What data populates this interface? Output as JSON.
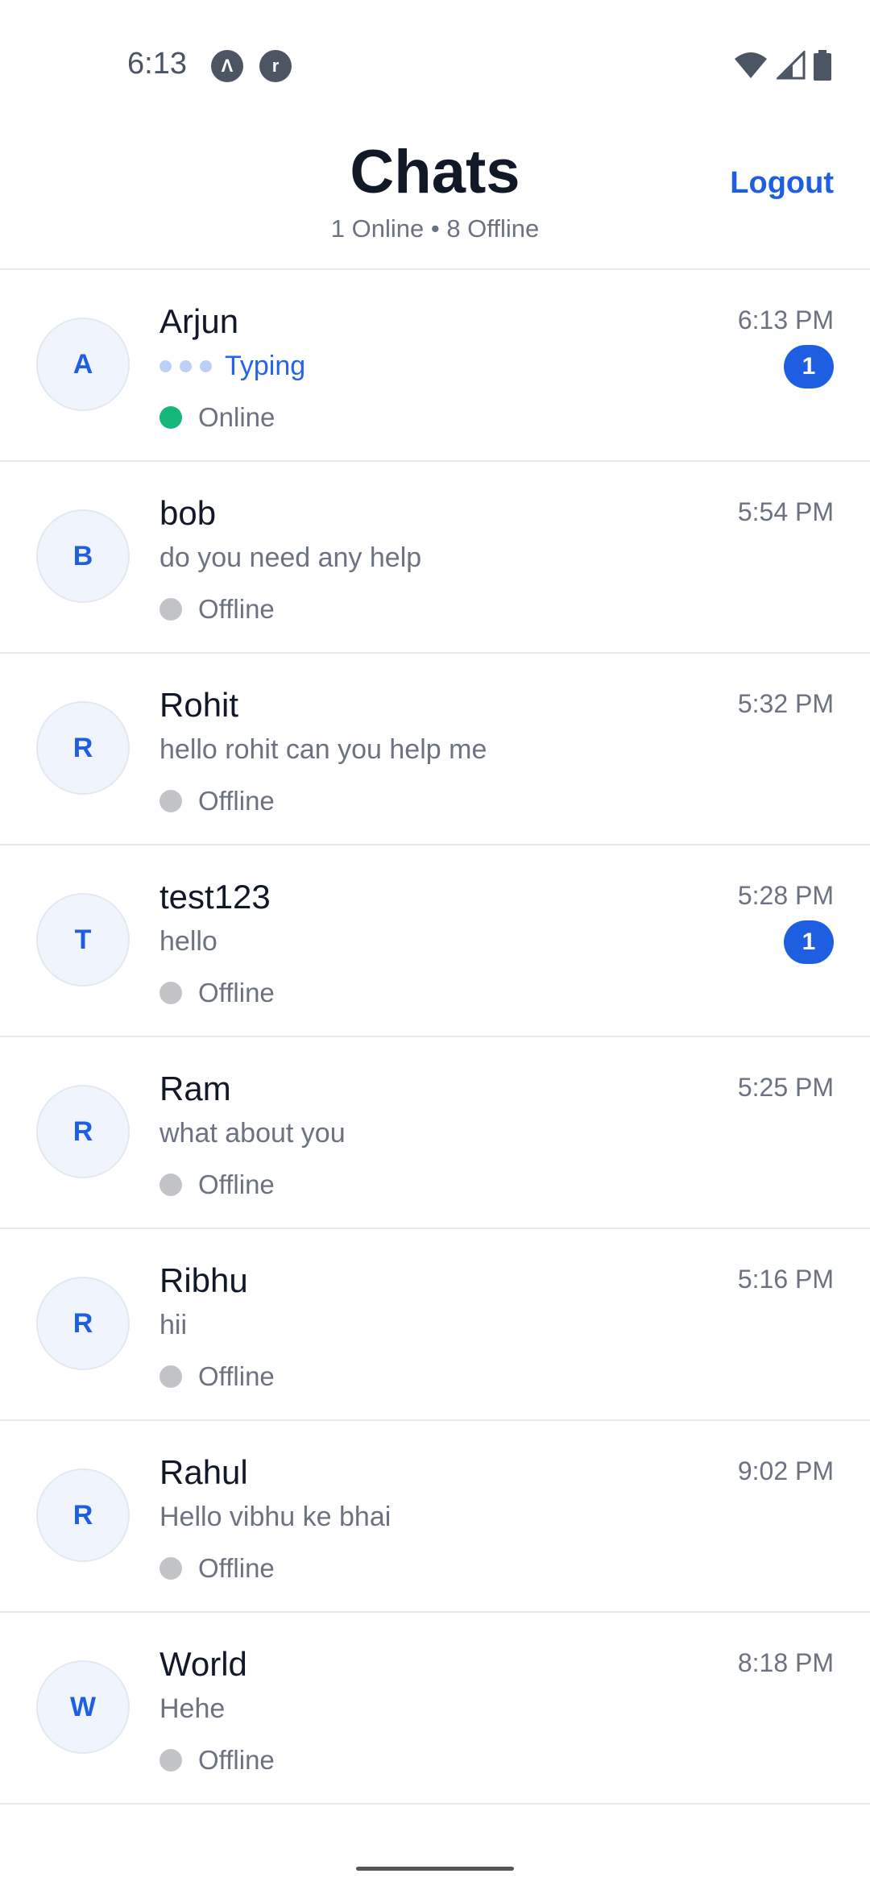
{
  "status_bar": {
    "time": "6:13",
    "icons": [
      "app-icon-a",
      "app-icon-r",
      "wifi-icon",
      "signal-icon",
      "battery-icon"
    ]
  },
  "header": {
    "title": "Chats",
    "subtitle": "1 Online • 8 Offline",
    "logout_label": "Logout"
  },
  "colors": {
    "accent": "#1d5fe0",
    "online": "#16b87a",
    "offline": "#c3c4c8"
  },
  "chats": [
    {
      "initial": "A",
      "name": "Arjun",
      "preview": "Typing",
      "typing": true,
      "status": "Online",
      "time": "6:13 PM",
      "unread": "1"
    },
    {
      "initial": "B",
      "name": "bob",
      "preview": "do you need any help",
      "status": "Offline",
      "time": "5:54 PM"
    },
    {
      "initial": "R",
      "name": "Rohit",
      "preview": "hello rohit can you help me",
      "status": "Offline",
      "time": "5:32 PM"
    },
    {
      "initial": "T",
      "name": "test123",
      "preview": "hello",
      "status": "Offline",
      "time": "5:28 PM",
      "unread": "1"
    },
    {
      "initial": "R",
      "name": "Ram",
      "preview": "what about you",
      "status": "Offline",
      "time": "5:25 PM"
    },
    {
      "initial": "R",
      "name": "Ribhu",
      "preview": "hii",
      "status": "Offline",
      "time": "5:16 PM"
    },
    {
      "initial": "R",
      "name": "Rahul",
      "preview": "Hello vibhu ke bhai",
      "status": "Offline",
      "time": "9:02 PM"
    },
    {
      "initial": "W",
      "name": "World",
      "preview": "Hehe",
      "status": "Offline",
      "time": "8:18 PM"
    }
  ]
}
